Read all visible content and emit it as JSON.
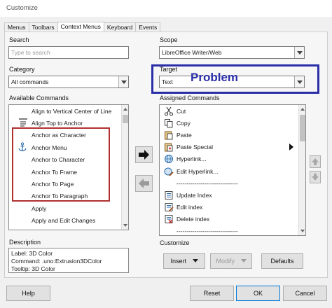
{
  "window": {
    "title": "Customize"
  },
  "tabs": [
    "Menus",
    "Toolbars",
    "Context Menus",
    "Keyboard",
    "Events"
  ],
  "search": {
    "label": "Search",
    "placeholder": "Type to search"
  },
  "category": {
    "label": "Category",
    "value": "All commands"
  },
  "available": {
    "label": "Available Commands",
    "items": [
      "Align to Vertical Center of Line",
      "Align Top to Anchor",
      "Anchor as Character",
      "Anchor Menu",
      "Anchor to Character",
      "Anchor To Frame",
      "Anchor To Page",
      "Anchor To Paragraph",
      "Apply",
      "Apply and Edit Changes"
    ]
  },
  "scope": {
    "label": "Scope",
    "value": "LibreOffice Writer/Web"
  },
  "target": {
    "label": "Target",
    "value": "Text"
  },
  "annotation": {
    "text": "Problem",
    "color": "#2a2fa8"
  },
  "highlight_color": "#b03030",
  "assigned": {
    "label": "Assigned Commands",
    "items": [
      "Cut",
      "Copy",
      "Paste",
      "Paste Special",
      "Hyperlink...",
      "Edit Hyperlink...",
      "-------------------------------",
      "Update Index",
      "Edit index",
      "Delete index",
      "-------------------------------"
    ]
  },
  "description": {
    "label": "Description",
    "lines": [
      "Label: 3D Color",
      "Command: .uno:Extrusion3DColor",
      "Tooltip: 3D Color"
    ]
  },
  "customize": {
    "label": "Customize",
    "insert": "Insert",
    "modify": "Modify",
    "defaults": "Defaults"
  },
  "footer": {
    "help": "Help",
    "reset": "Reset",
    "ok": "OK",
    "cancel": "Cancel"
  }
}
